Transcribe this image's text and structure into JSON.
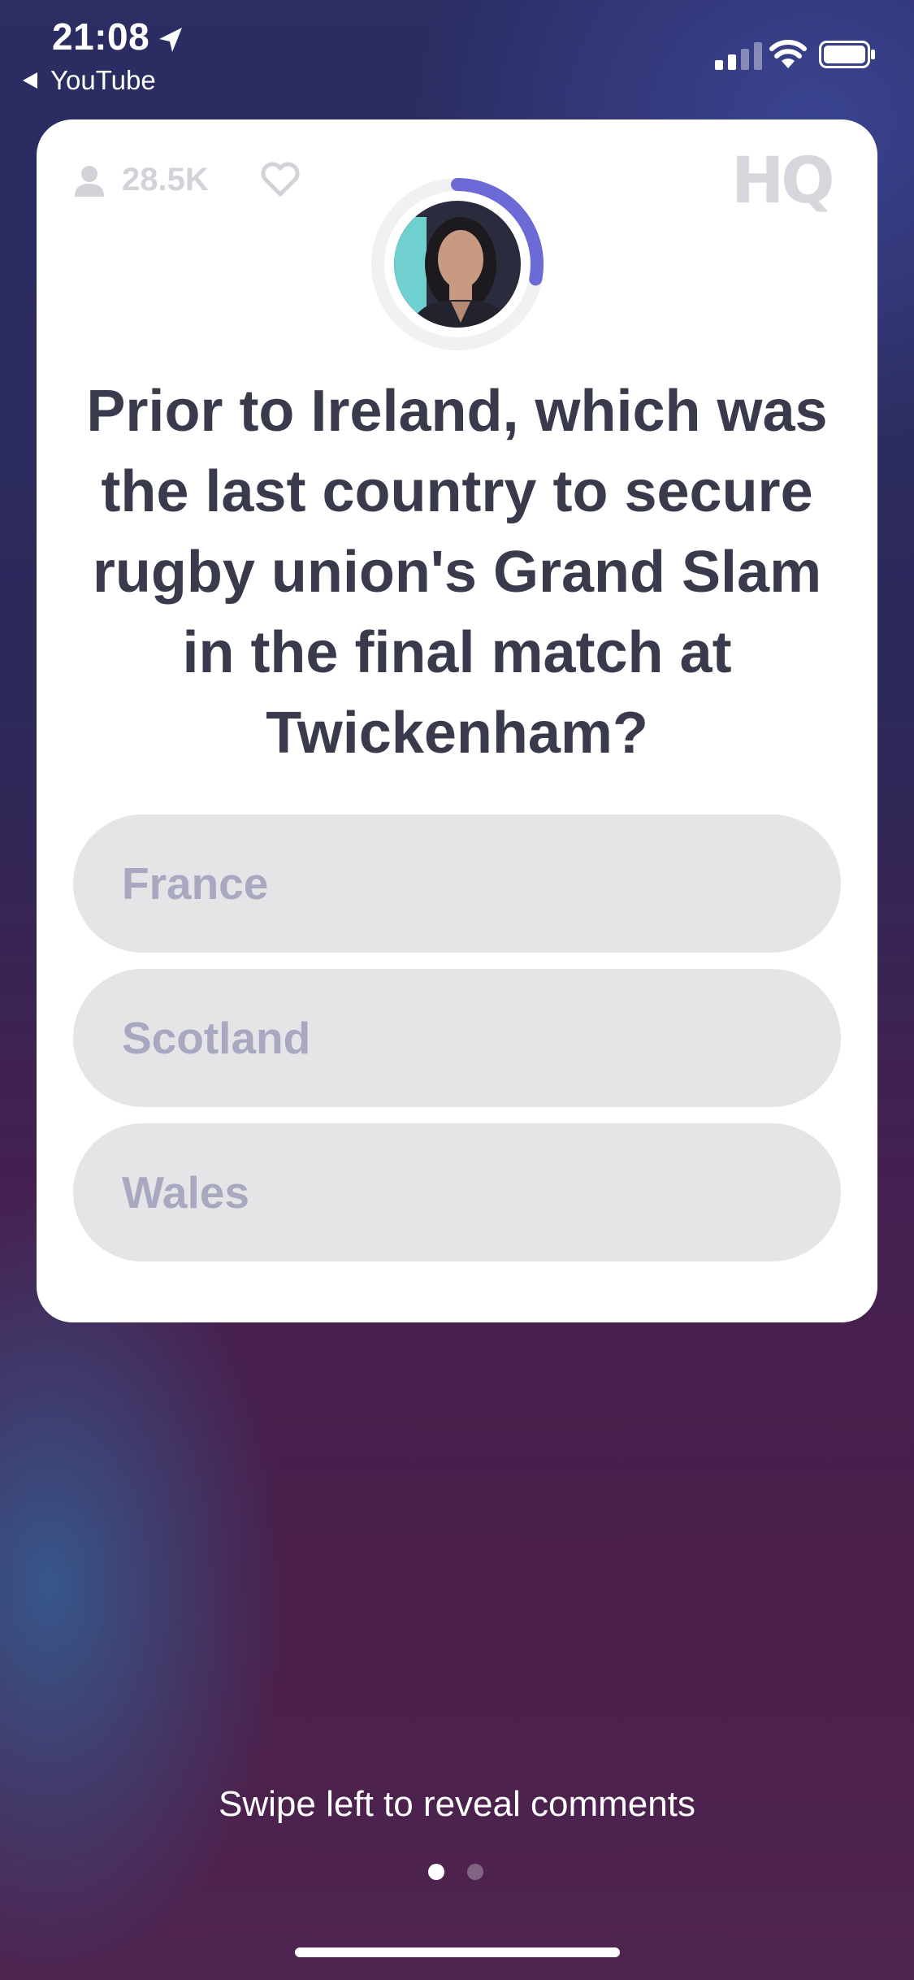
{
  "status_bar": {
    "time": "21:08",
    "back_app": "YouTube"
  },
  "card": {
    "viewer_count": "28.5K",
    "logo_text": "HQ",
    "timer_progress": 0.28,
    "question": "Prior to Ireland, which was the last country to secure rugby union's Grand Slam in the final match at Twickenham?",
    "answers": [
      "France",
      "Scotland",
      "Wales"
    ]
  },
  "footer": {
    "hint": "Swipe left to reveal comments",
    "page_dots": {
      "count": 2,
      "active": 0
    }
  },
  "colors": {
    "accent": "#6b6ad6",
    "question_text": "#3a3a4d",
    "answer_bg": "#e5e5e7",
    "answer_text": "#a8a8c0"
  },
  "icons": [
    "location-arrow-icon",
    "back-triangle-icon",
    "cellular-signal-icon",
    "wifi-icon",
    "battery-icon",
    "person-icon",
    "heart-icon",
    "hq-logo"
  ]
}
